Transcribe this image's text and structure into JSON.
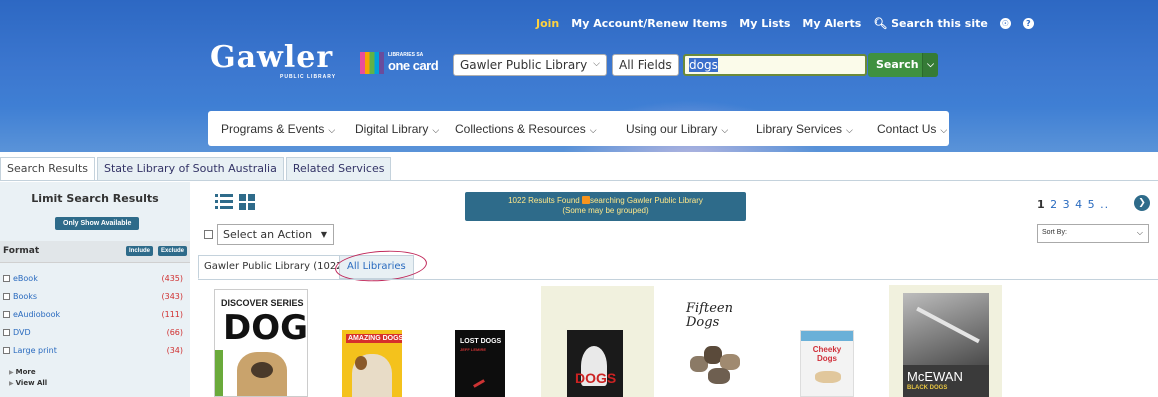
{
  "header": {
    "links": [
      "Join",
      "My Account/Renew Items",
      "My Lists",
      "My Alerts",
      "Search this site"
    ],
    "logo_text": "Gawler",
    "logo_sub": "PUBLIC LIBRARY",
    "onecard_top": "LIBRARIES SA",
    "onecard_main": "one card"
  },
  "search": {
    "library_select": "Gawler Public Library",
    "field_select": "All Fields",
    "query": "dogs",
    "button": "Search"
  },
  "mainnav": [
    "Programs & Events",
    "Digital Library",
    "Collections & Resources",
    "Using our Library",
    "Library Services",
    "Contact Us"
  ],
  "tabs": [
    "Search Results",
    "State Library of South Australia",
    "Related Services"
  ],
  "sidebar": {
    "title": "Limit Search Results",
    "only_available": "Only Show Available",
    "format_label": "Format",
    "include": "Include",
    "exclude": "Exclude",
    "formats": [
      {
        "label": "eBook",
        "count": "(435)"
      },
      {
        "label": "Books",
        "count": "(343)"
      },
      {
        "label": "eAudiobook",
        "count": "(111)"
      },
      {
        "label": "DVD",
        "count": "(66)"
      },
      {
        "label": "Large print",
        "count": "(34)"
      }
    ],
    "more": "More",
    "view_all": "View All"
  },
  "results": {
    "line1_a": "1022 Results Found",
    "line1_b": "searching Gawler Public Library",
    "line2": "(Some may be grouped)"
  },
  "pagination": {
    "current": "1",
    "others": "2 3 4 5 .."
  },
  "actions": {
    "select": "Select an Action",
    "sort": "Sort By:"
  },
  "library_tabs": [
    "Gawler Public Library (1022)",
    "All Libraries"
  ],
  "covers": {
    "c1_top": "DISCOVER SERIES",
    "c1_main": "DOGS",
    "c2_main": "AMAZING DOGS",
    "c3_main": "LOST DOGS",
    "c3_sub": "JEFF LEMIRE",
    "c4_main": "DOGS",
    "c5_main": "Fifteen Dogs",
    "c6_main": "Cheeky Dogs",
    "c7_main": "McEWAN",
    "c7_sub": "BLACK DOGS"
  },
  "colors": {
    "banner": "#2d68c3",
    "join": "#ffd23f",
    "search_btn": "#3f9140",
    "panel": "#2e6b8a",
    "count": "#d03030",
    "link": "#2a6bbf"
  }
}
